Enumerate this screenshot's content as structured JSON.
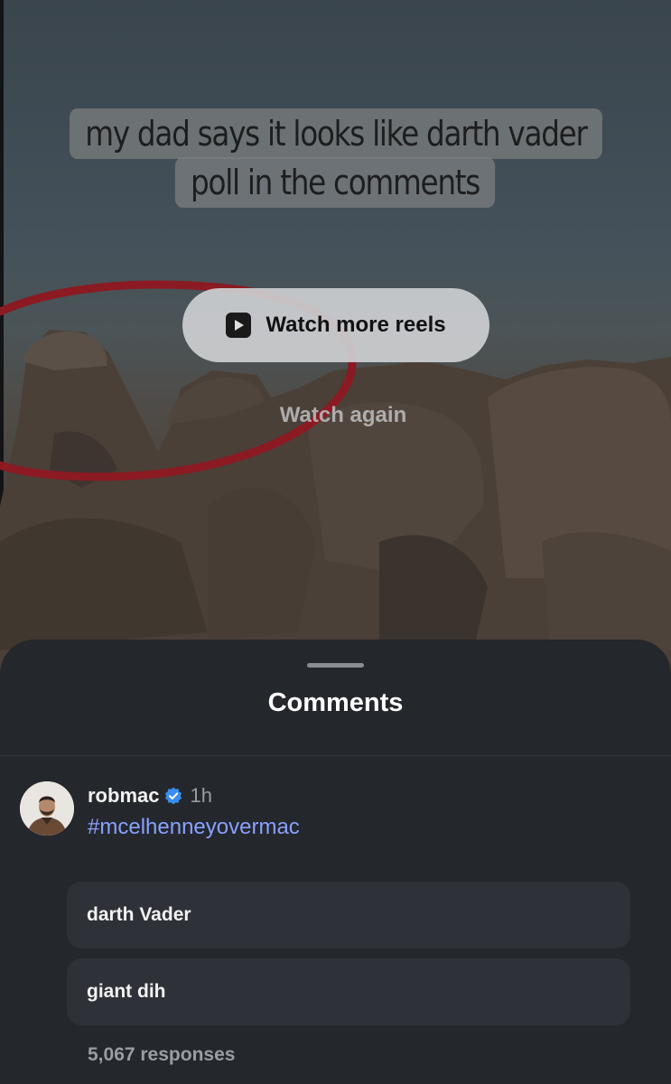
{
  "reel": {
    "caption_line1": "my dad says it looks like darth vader",
    "caption_line2": "poll in the comments",
    "watch_more_label": "Watch more reels",
    "watch_again_label": "Watch again"
  },
  "comments_sheet": {
    "title": "Comments",
    "comment": {
      "username": "robmac",
      "verified": true,
      "timestamp": "1h",
      "text": "#mcelhenneyovermac"
    },
    "poll": {
      "options": [
        {
          "label": "darth Vader"
        },
        {
          "label": "giant dih"
        }
      ],
      "responses_label": "5,067 responses"
    }
  },
  "colors": {
    "sheet_bg": "#24272c",
    "hashtag": "#8aa0ff",
    "verified": "#3b8df0",
    "circle_annotation": "#8b1a22"
  },
  "icons": {
    "watch_more": "play-square-icon",
    "verified": "verified-badge-icon"
  }
}
